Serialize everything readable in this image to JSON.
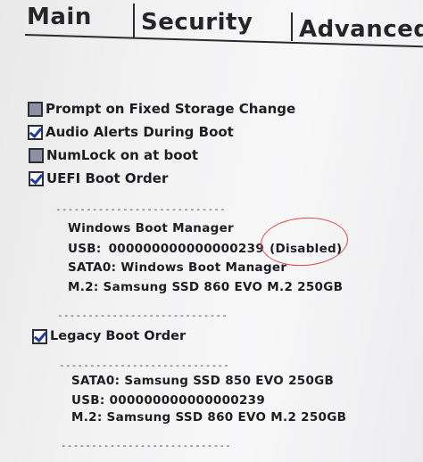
{
  "tabs": [
    {
      "label": "Main"
    },
    {
      "label": "Security"
    },
    {
      "label": "Advanced"
    }
  ],
  "options": [
    {
      "label": "Prompt on Fixed Storage Change",
      "checked": false
    },
    {
      "label": "Audio Alerts During Boot",
      "checked": true
    },
    {
      "label": "NumLock on at boot",
      "checked": false
    },
    {
      "label": "UEFI Boot Order",
      "checked": true
    }
  ],
  "separator": "----------------------------",
  "uefi_boot_order": {
    "windows_boot_manager": "Windows Boot Manager",
    "usb_label": "USB:",
    "usb_value": "000000000000000239",
    "usb_status": "(Disabled)",
    "sata0": "SATA0:  Windows Boot Manager",
    "m2": "M.2:  Samsung SSD 860 EVO M.2 250GB"
  },
  "legacy_boot_order": {
    "label": "Legacy Boot Order",
    "checked": true,
    "sata0": "SATA0:  Samsung SSD 850 EVO 250GB",
    "usb": "USB:  000000000000000239",
    "m2": "M.2:  Samsung SSD 860 EVO M.2 250GB"
  },
  "colors": {
    "annotation_circle": "#d94b4b",
    "check_mark": "#1f3e9e"
  }
}
